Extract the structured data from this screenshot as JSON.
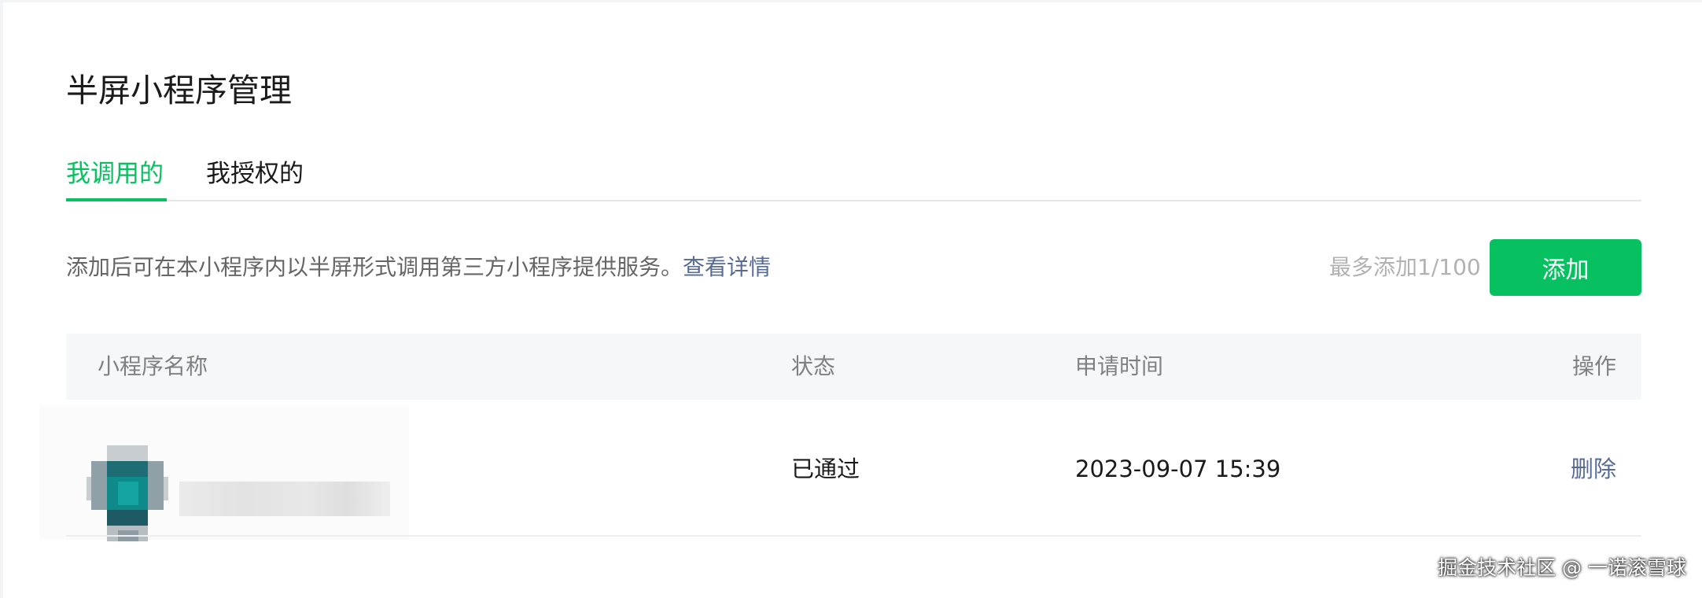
{
  "page": {
    "title": "半屏小程序管理"
  },
  "tabs": [
    {
      "label": "我调用的",
      "active": true
    },
    {
      "label": "我授权的",
      "active": false
    }
  ],
  "description": {
    "text": "添加后可在本小程序内以半屏形式调用第三方小程序提供服务。",
    "link_label": "查看详情"
  },
  "toolbar": {
    "limit_text": "最多添加1/100",
    "add_label": "添加"
  },
  "table": {
    "headers": {
      "name": "小程序名称",
      "status": "状态",
      "time": "申请时间",
      "operation": "操作"
    },
    "rows": [
      {
        "name": "",
        "status": "已通过",
        "time": "2023-09-07 15:39",
        "action": "删除"
      }
    ]
  },
  "watermark": "掘金技术社区 @ 一诺滚雪球",
  "colors": {
    "accent": "#07c160",
    "link": "#576b95",
    "text": "#1a1a1a",
    "muted": "#808080",
    "header_bg": "#f6f7f8"
  }
}
